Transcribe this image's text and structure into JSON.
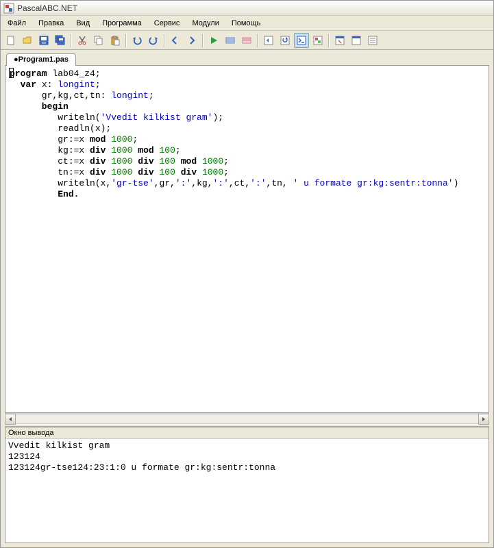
{
  "app": {
    "title": "PascalABC.NET"
  },
  "menu": {
    "file": "Файл",
    "edit": "Правка",
    "view": "Вид",
    "program": "Программа",
    "service": "Сервис",
    "modules": "Модули",
    "help": "Помощь"
  },
  "tab": {
    "label": "●Program1.pas"
  },
  "code": {
    "l1a": "program",
    "l1b": " lab04_z4;",
    "l2a": "  var",
    "l2b": " x: ",
    "l2c": "longint",
    "l2d": ";",
    "l3a": "      gr,kg,ct,tn: ",
    "l3b": "longint",
    "l3c": ";",
    "l4a": "      begin",
    "l5a": "         writeln(",
    "l5b": "'Vvedit kilkist gram'",
    "l5c": ");",
    "l6a": "         readln(x);",
    "l7a": "         gr:=x ",
    "l7b": "mod",
    "l7c": " ",
    "l7d": "1000",
    "l7e": ";",
    "l8a": "         kg:=x ",
    "l8b": "div",
    "l8c": " ",
    "l8d": "1000",
    "l8e": " ",
    "l8f": "mod",
    "l8g": " ",
    "l8h": "100",
    "l8i": ";",
    "l9a": "         ct:=x ",
    "l9b": "div",
    "l9c": " ",
    "l9d": "1000",
    "l9e": " ",
    "l9f": "div",
    "l9g": " ",
    "l9h": "100",
    "l9i": " ",
    "l9j": "mod",
    "l9k": " ",
    "l9l": "1000",
    "l9m": ";",
    "l10a": "         tn:=x ",
    "l10b": "div",
    "l10c": " ",
    "l10d": "1000",
    "l10e": " ",
    "l10f": "div",
    "l10g": " ",
    "l10h": "100",
    "l10i": " ",
    "l10j": "div",
    "l10k": " ",
    "l10l": "1000",
    "l10m": ";",
    "l11a": "         writeln(x,",
    "l11b": "'gr-tse'",
    "l11c": ",gr,",
    "l11d": "':'",
    "l11e": ",kg,",
    "l11f": "':'",
    "l11g": ",ct,",
    "l11h": "':'",
    "l11i": ",tn, ",
    "l11j": "' u formate gr:kg:sentr:tonna'",
    "l11k": ")",
    "l12a": "         End."
  },
  "output": {
    "title": "Окно вывода",
    "line1": "Vvedit kilkist gram",
    "line2": "123124",
    "line3": "123124gr-tse124:23:1:0 u formate gr:kg:sentr:tonna"
  }
}
